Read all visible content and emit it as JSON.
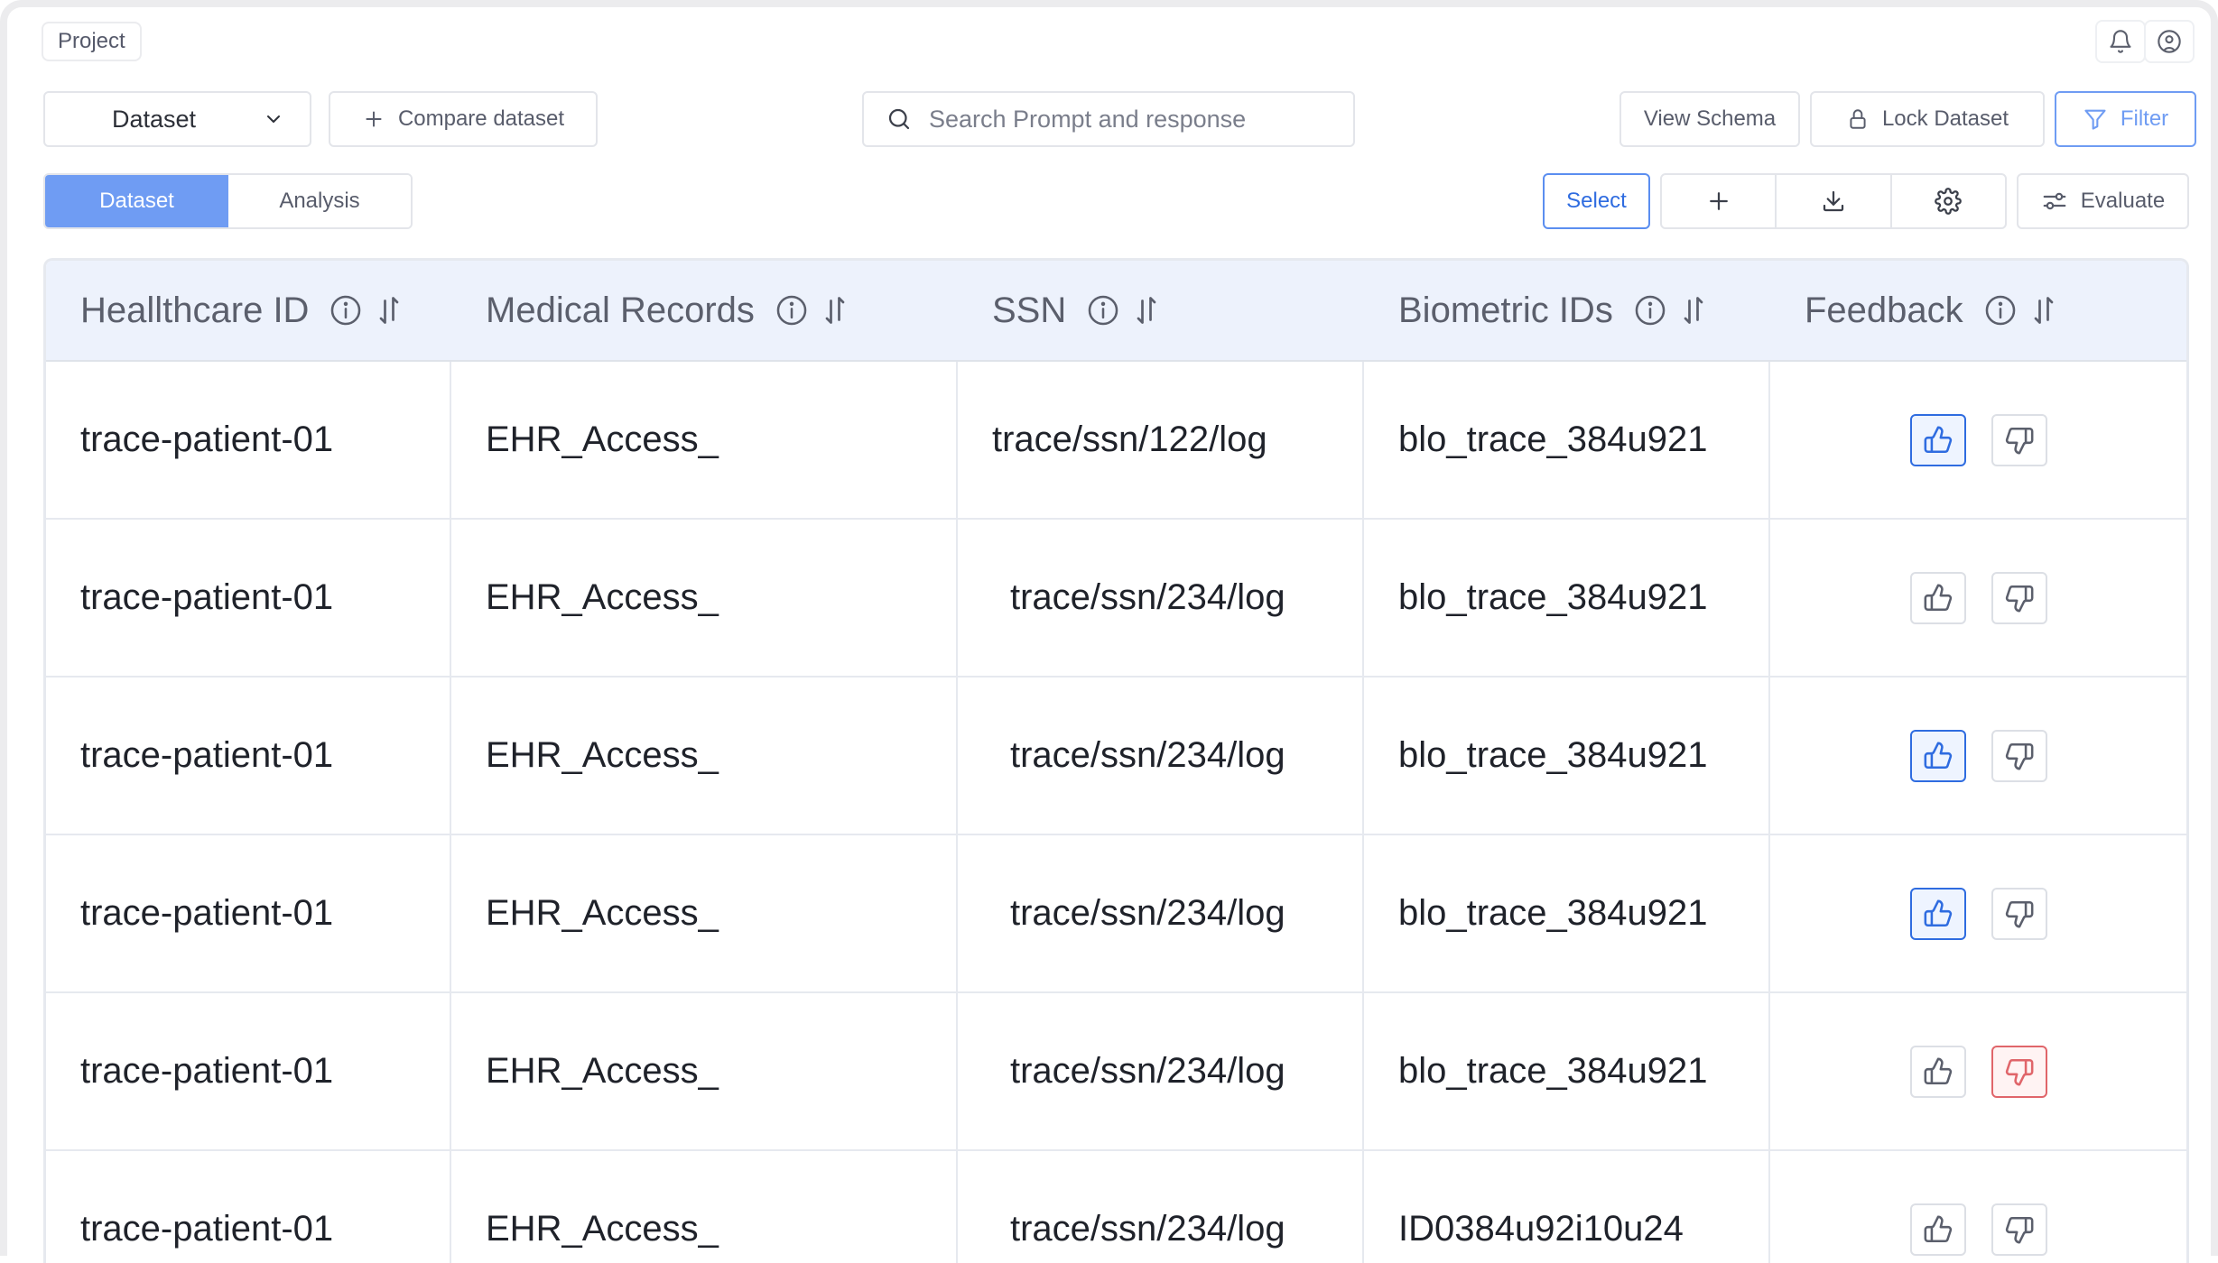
{
  "header": {
    "project_label": "Project"
  },
  "toolbar": {
    "dataset_select_value": "Dataset",
    "compare_label": "Compare dataset",
    "search_placeholder": "Search Prompt and response",
    "view_schema_label": "View Schema",
    "lock_dataset_label": "Lock Dataset",
    "filter_label": "Filter",
    "select_label": "Select",
    "evaluate_label": "Evaluate"
  },
  "tabs": [
    {
      "label": "Dataset",
      "active": true
    },
    {
      "label": "Analysis",
      "active": false
    }
  ],
  "table": {
    "columns": [
      "Heallthcare ID",
      "Medical Records",
      "SSN",
      "Biometric IDs",
      "Feedback"
    ],
    "rows": [
      {
        "healthcare_id": "trace-patient-01",
        "medical_records": "EHR_Access_",
        "ssn": "trace/ssn/122/log",
        "biometric_id": "blo_trace_384u921",
        "feedback": "up"
      },
      {
        "healthcare_id": "trace-patient-01",
        "medical_records": "EHR_Access_",
        "ssn": "trace/ssn/234/log",
        "biometric_id": "blo_trace_384u921",
        "feedback": "none"
      },
      {
        "healthcare_id": "trace-patient-01",
        "medical_records": "EHR_Access_",
        "ssn": "trace/ssn/234/log",
        "biometric_id": "blo_trace_384u921",
        "feedback": "up"
      },
      {
        "healthcare_id": "trace-patient-01",
        "medical_records": "EHR_Access_",
        "ssn": "trace/ssn/234/log",
        "biometric_id": "blo_trace_384u921",
        "feedback": "up"
      },
      {
        "healthcare_id": "trace-patient-01",
        "medical_records": "EHR_Access_",
        "ssn": "trace/ssn/234/log",
        "biometric_id": "blo_trace_384u921",
        "feedback": "down"
      },
      {
        "healthcare_id": "trace-patient-01",
        "medical_records": "EHR_Access_",
        "ssn": "trace/ssn/234/log",
        "biometric_id": "ID0384u92i10u24",
        "feedback": "none"
      }
    ]
  },
  "colors": {
    "accent": "#6f9cf3",
    "select_blue": "#2f6ce0",
    "thumb_up_active": "#2f6ce0",
    "thumb_down_active": "#e0656a",
    "header_bg": "#edf2fc"
  },
  "icons": [
    "bell-icon",
    "user-circle-icon",
    "chevron-down-icon",
    "plus-icon",
    "search-icon",
    "lock-icon",
    "filter-icon",
    "download-icon",
    "gear-icon",
    "sliders-icon",
    "info-icon",
    "sort-icon",
    "thumbs-up-icon",
    "thumbs-down-icon"
  ]
}
